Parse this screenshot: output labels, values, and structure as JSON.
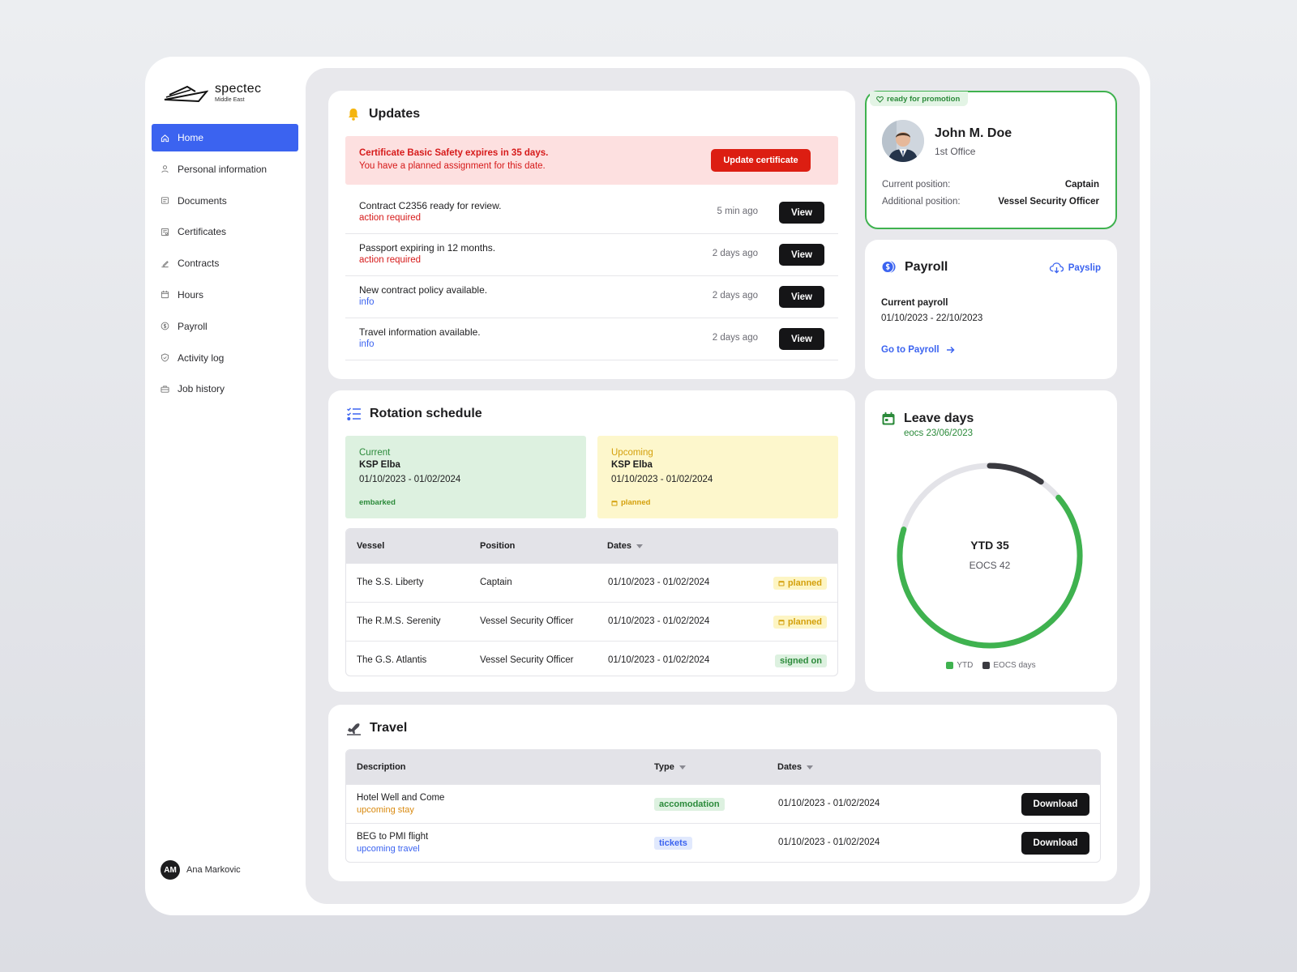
{
  "brand": {
    "name": "spectec",
    "sub": "Middle East"
  },
  "nav": [
    {
      "label": "Home",
      "icon": "home-icon",
      "active": true
    },
    {
      "label": "Personal information",
      "icon": "person-icon"
    },
    {
      "label": "Documents",
      "icon": "document-icon"
    },
    {
      "label": "Certificates",
      "icon": "certificate-icon"
    },
    {
      "label": "Contracts",
      "icon": "contract-icon"
    },
    {
      "label": "Hours",
      "icon": "calendar-icon"
    },
    {
      "label": "Payroll",
      "icon": "dollar-icon"
    },
    {
      "label": "Activity log",
      "icon": "shield-icon"
    },
    {
      "label": "Job history",
      "icon": "briefcase-icon"
    }
  ],
  "user": {
    "initials": "AM",
    "name": "Ana Markovic"
  },
  "updates": {
    "title": "Updates",
    "alert": {
      "title": "Certificate Basic Safety expires in 35 days.",
      "text": "You have a planned assignment for this date.",
      "button": "Update certificate"
    },
    "items": [
      {
        "text": "Contract C2356 ready for review.",
        "tag": "action required",
        "tagColor": "red",
        "time": "5 min ago",
        "button": "View"
      },
      {
        "text": "Passport expiring in 12 months.",
        "tag": "action required",
        "tagColor": "red",
        "time": "2 days ago",
        "button": "View"
      },
      {
        "text": "New contract policy available.",
        "tag": "info",
        "tagColor": "blue",
        "time": "2 days ago",
        "button": "View"
      },
      {
        "text": "Travel information available.",
        "tag": "info",
        "tagColor": "blue",
        "time": "2 days ago",
        "button": "View"
      }
    ]
  },
  "profile": {
    "badge": "ready for promotion",
    "name": "John M. Doe",
    "office": "1st Office",
    "current_label": "Current position:",
    "current_value": "Captain",
    "additional_label": "Additional position:",
    "additional_value": "Vessel Security Officer"
  },
  "payroll": {
    "title": "Payroll",
    "payslip": "Payslip",
    "current_label": "Current payroll",
    "dates": "01/10/2023 - 22/10/2023",
    "link": "Go to Payroll"
  },
  "rotation": {
    "title": "Rotation schedule",
    "current": {
      "label": "Current",
      "vessel": "KSP Elba",
      "dates": "01/10/2023 - 01/02/2024",
      "status": "embarked"
    },
    "upcoming": {
      "label": "Upcoming",
      "vessel": "KSP Elba",
      "dates": "01/10/2023 - 01/02/2024",
      "status": "planned"
    },
    "columns": [
      "Vessel",
      "Position",
      "Dates"
    ],
    "rows": [
      {
        "vessel": "The S.S. Liberty",
        "position": "Captain",
        "dates": "01/10/2023 - 01/02/2024",
        "status": "planned",
        "statusColor": "yellow"
      },
      {
        "vessel": "The R.M.S. Serenity",
        "position": "Vessel Security Officer",
        "dates": "01/10/2023 - 01/02/2024",
        "status": "planned",
        "statusColor": "yellow"
      },
      {
        "vessel": "The G.S. Atlantis",
        "position": "Vessel Security Officer",
        "dates": "01/10/2023 - 01/02/2024",
        "status": "signed on",
        "statusColor": "green"
      }
    ]
  },
  "leave": {
    "title": "Leave days",
    "sub": "eocs 23/06/2023",
    "center_main": "YTD 35",
    "center_sub": "EOCS 42",
    "legend": [
      "YTD",
      "EOCS days"
    ],
    "ytd": 35,
    "eocs": 42,
    "colors": {
      "ytd": "#3fb24f",
      "eocs": "#3a3a40",
      "track": "#e3e3e8"
    }
  },
  "travel": {
    "title": "Travel",
    "columns": [
      "Description",
      "Type",
      "Dates"
    ],
    "rows": [
      {
        "desc": "Hotel Well and Come",
        "sub": "upcoming stay",
        "subColor": "orange",
        "type": "accomodation",
        "typeColor": "green",
        "dates": "01/10/2023 - 01/02/2024",
        "button": "Download"
      },
      {
        "desc": "BEG to PMI flight",
        "sub": "upcoming travel",
        "subColor": "blue",
        "type": "tickets",
        "typeColor": "blue",
        "dates": "01/10/2023 - 01/02/2024",
        "button": "Download"
      }
    ]
  },
  "colors": {
    "accent": "#3b63f0",
    "danger": "#dc1e12",
    "success": "#3fb24f",
    "warning": "#d4a00c"
  }
}
